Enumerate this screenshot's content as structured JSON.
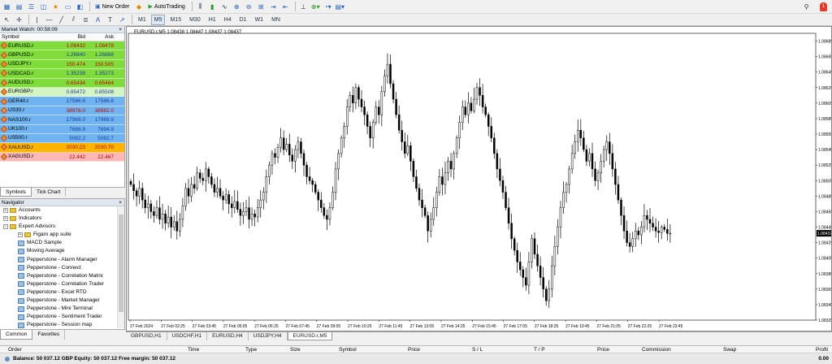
{
  "toolbar": {
    "new_order": "New Order",
    "auto_trading": "AutoTrading",
    "timeframes": [
      "M1",
      "M5",
      "M15",
      "M30",
      "H1",
      "H4",
      "D1",
      "W1",
      "MN"
    ],
    "active_timeframe": "M5"
  },
  "market_watch": {
    "title": "Market Watch: 00:58:09",
    "col_symbol": "Symbol",
    "col_bid": "Bid",
    "col_ask": "Ask",
    "rows": [
      {
        "symbol": "EURUSD.r",
        "bid": "1.08432",
        "ask": "1.08478",
        "bg": "#7fdc3a",
        "color": "#c00000"
      },
      {
        "symbol": "GBPUSD.r",
        "bid": "1.26840",
        "ask": "1.26888",
        "bg": "#7fdc3a",
        "color": "#1a3aa0"
      },
      {
        "symbol": "USDJPY.r",
        "bid": "150.474",
        "ask": "150.505",
        "bg": "#7fdc3a",
        "color": "#c00000"
      },
      {
        "symbol": "USDCAD.r",
        "bid": "1.35238",
        "ask": "1.35273",
        "bg": "#7fdc3a",
        "color": "#1a3aa0"
      },
      {
        "symbol": "AUDUSD.r",
        "bid": "0.65434",
        "ask": "0.65464",
        "bg": "#7fdc3a",
        "color": "#c00000"
      },
      {
        "symbol": "EURGBP.r",
        "bid": "0.85472",
        "ask": "0.85508",
        "bg": "#d4f5c4",
        "color": "#1a3aa0"
      },
      {
        "symbol": "GER40.r",
        "bid": "17586.6",
        "ask": "17586.8",
        "bg": "#6fb4f0",
        "color": "#1a3aa0"
      },
      {
        "symbol": "US30.r",
        "bid": "38978.0",
        "ask": "38982.0",
        "bg": "#6fb4f0",
        "color": "#c00000"
      },
      {
        "symbol": "NAS100.r",
        "bid": "17968.0",
        "ask": "17969.9",
        "bg": "#6fb4f0",
        "color": "#1a3aa0"
      },
      {
        "symbol": "UK100.r",
        "bid": "7688.9",
        "ask": "7694.9",
        "bg": "#6fb4f0",
        "color": "#1a3aa0"
      },
      {
        "symbol": "US500.r",
        "bid": "5082.2",
        "ask": "5082.7",
        "bg": "#6fb4f0",
        "color": "#1a3aa0"
      },
      {
        "symbol": "XAUUSD.r",
        "bid": "2030.23",
        "ask": "2030.70",
        "bg": "#ffb400",
        "color": "#c00000"
      },
      {
        "symbol": "XAGUSD.r",
        "bid": "22.442",
        "ask": "22.467",
        "bg": "#ffb8b8",
        "color": "#c00000"
      }
    ],
    "tabs": [
      "Symbols",
      "Tick Chart"
    ]
  },
  "navigator": {
    "title": "Navigator",
    "items": [
      {
        "label": "Accounts",
        "level": 0,
        "icon": "accounts-icon"
      },
      {
        "label": "Indicators",
        "level": 0,
        "icon": "indicators-icon"
      },
      {
        "label": "Expert Advisors",
        "level": 0,
        "icon": "folder-icon"
      },
      {
        "label": "Figaro app suite",
        "level": 1,
        "icon": "folder-icon"
      },
      {
        "label": "MACD Sample",
        "level": 1,
        "icon": "expert-icon"
      },
      {
        "label": "Moving Average",
        "level": 1,
        "icon": "expert-icon"
      },
      {
        "label": "Pepperstone - Alarm Manager",
        "level": 1,
        "icon": "expert-icon"
      },
      {
        "label": "Pepperstone - Connect",
        "level": 1,
        "icon": "expert-icon"
      },
      {
        "label": "Pepperstone - Correlation Matrix",
        "level": 1,
        "icon": "expert-icon"
      },
      {
        "label": "Pepperstone - Correlation Trader",
        "level": 1,
        "icon": "expert-icon"
      },
      {
        "label": "Pepperstone - Excel RTD",
        "level": 1,
        "icon": "expert-icon"
      },
      {
        "label": "Pepperstone - Market Manager",
        "level": 1,
        "icon": "expert-icon"
      },
      {
        "label": "Pepperstone - Mini Terminal",
        "level": 1,
        "icon": "expert-icon"
      },
      {
        "label": "Pepperstone - Sentiment Trader",
        "level": 1,
        "icon": "expert-icon"
      },
      {
        "label": "Pepperstone - Session map",
        "level": 1,
        "icon": "expert-icon"
      },
      {
        "label": "Pepperstone - Stealth Orders",
        "level": 1,
        "icon": "expert-icon"
      },
      {
        "label": "Pepperstone - Tick Chart Trader",
        "level": 1,
        "icon": "expert-icon"
      },
      {
        "label": "Pepperstone - Trade Terminal",
        "level": 1,
        "icon": "expert-icon"
      }
    ],
    "tabs": [
      "Common",
      "Favorites"
    ]
  },
  "chart": {
    "header": "EURUSD.r,M5  1.08438 1.08447 1.08437 1.08437",
    "price_labels": [
      "1.08685",
      "1.08665",
      "1.08645",
      "1.08625",
      "1.08605",
      "1.08585",
      "1.08565",
      "1.08545",
      "1.08525",
      "1.08505",
      "1.08485",
      "1.08465",
      "1.08445",
      "1.08425",
      "1.08405",
      "1.08385",
      "1.08365",
      "1.08345",
      "1.08325"
    ],
    "current_price": "1.08437",
    "time_labels": [
      "27 Feb 2024",
      "27 Feb 02:25",
      "27 Feb 03:45",
      "27 Feb 05:05",
      "27 Feb 06:25",
      "27 Feb 07:45",
      "27 Feb 09:05",
      "27 Feb 10:25",
      "27 Feb 11:45",
      "27 Feb 13:05",
      "27 Feb 14:25",
      "27 Feb 15:45",
      "27 Feb 17:05",
      "27 Feb 18:25",
      "27 Feb 19:45",
      "27 Feb 21:05",
      "27 Feb 22:25",
      "27 Feb 23:45"
    ],
    "tabs": [
      "GBPUSD,H1",
      "USDCHF,H1",
      "EURUSD,H4",
      "USDJPY,H4",
      "EURUSD.r,M5"
    ],
    "active_tab": "EURUSD.r,M5"
  },
  "chart_data": {
    "type": "candlestick",
    "title": "EURUSD.r,M5",
    "ylim": [
      1.08325,
      1.08695
    ],
    "close": [
      1.085,
      1.08492,
      1.08485,
      1.08495,
      1.0848,
      1.0847,
      1.08475,
      1.08465,
      1.0846,
      1.0847,
      1.08455,
      1.08462,
      1.0845,
      1.08458,
      1.08445,
      1.08452,
      1.0844,
      1.08455,
      1.08472,
      1.08495,
      1.08485,
      1.085,
      1.08495,
      1.08515,
      1.08508,
      1.08505,
      1.0852,
      1.0851,
      1.085,
      1.0849,
      1.08495,
      1.08485,
      1.0848,
      1.08487,
      1.08475,
      1.0847,
      1.08478,
      1.08468,
      1.0846,
      1.08465,
      1.0847,
      1.08455,
      1.08462,
      1.08458,
      1.0847,
      1.0848,
      1.0849,
      1.0851,
      1.08525,
      1.0854,
      1.08535,
      1.08548,
      1.0856,
      1.08545,
      1.08552,
      1.08538,
      1.0853,
      1.08545,
      1.08555,
      1.0854,
      1.08525,
      1.0851,
      1.08505,
      1.085,
      1.0849,
      1.0848,
      1.0847,
      1.0846,
      1.08455,
      1.0847,
      1.0849,
      1.0852,
      1.0854,
      1.0856,
      1.08575,
      1.086,
      1.08615,
      1.08605,
      1.08625,
      1.0861,
      1.086,
      1.0859,
      1.08575,
      1.0856,
      1.0858,
      1.086,
      1.0859,
      1.0862,
      1.0864,
      1.08655,
      1.0863,
      1.0861,
      1.0859,
      1.0857,
      1.08555,
      1.0854,
      1.0855,
      1.0853,
      1.0851,
      1.08495,
      1.0848,
      1.0847,
      1.0846,
      1.0844,
      1.08455,
      1.0847,
      1.0849,
      1.0851,
      1.085,
      1.08515,
      1.0853,
      1.0852,
      1.0854,
      1.0856,
      1.0858,
      1.086,
      1.0859,
      1.08605,
      1.08595,
      1.0861,
      1.08625,
      1.08615,
      1.086,
      1.0859,
      1.08575,
      1.0856,
      1.0854,
      1.0852,
      1.08505,
      1.0849,
      1.0847,
      1.0845,
      1.0843,
      1.08415,
      1.084,
      1.0839,
      1.0838,
      1.0837,
      1.084,
      1.0843,
      1.0841,
      1.08395,
      1.0838,
      1.08365,
      1.0835,
      1.08365,
      1.08395,
      1.0842,
      1.08445,
      1.0847,
      1.0849,
      1.085,
      1.0852,
      1.0854,
      1.08555,
      1.0857,
      1.0856,
      1.08545,
      1.0853,
      1.0854,
      1.0852,
      1.08505,
      1.08515,
      1.0853,
      1.08545,
      1.08555,
      1.0854,
      1.0852,
      1.085,
      1.0848,
      1.0846,
      1.0844,
      1.08425,
      1.0842,
      1.0843,
      1.0844,
      1.08435,
      1.08445,
      1.0846,
      1.08455,
      1.0845,
      1.08445,
      1.0844,
      1.08438,
      1.08445,
      1.08442,
      1.08437,
      1.08437
    ]
  },
  "terminal": {
    "columns": [
      "Order",
      "Time",
      "Type",
      "Size",
      "Symbol",
      "Price",
      "S / L",
      "T / P",
      "Price",
      "Commission",
      "Swap",
      "Profit"
    ],
    "balance_row": "Balance: 50 037.12 GBP  Equity: 50 037.12  Free margin: 50 037.12",
    "profit_value": "0.00"
  }
}
